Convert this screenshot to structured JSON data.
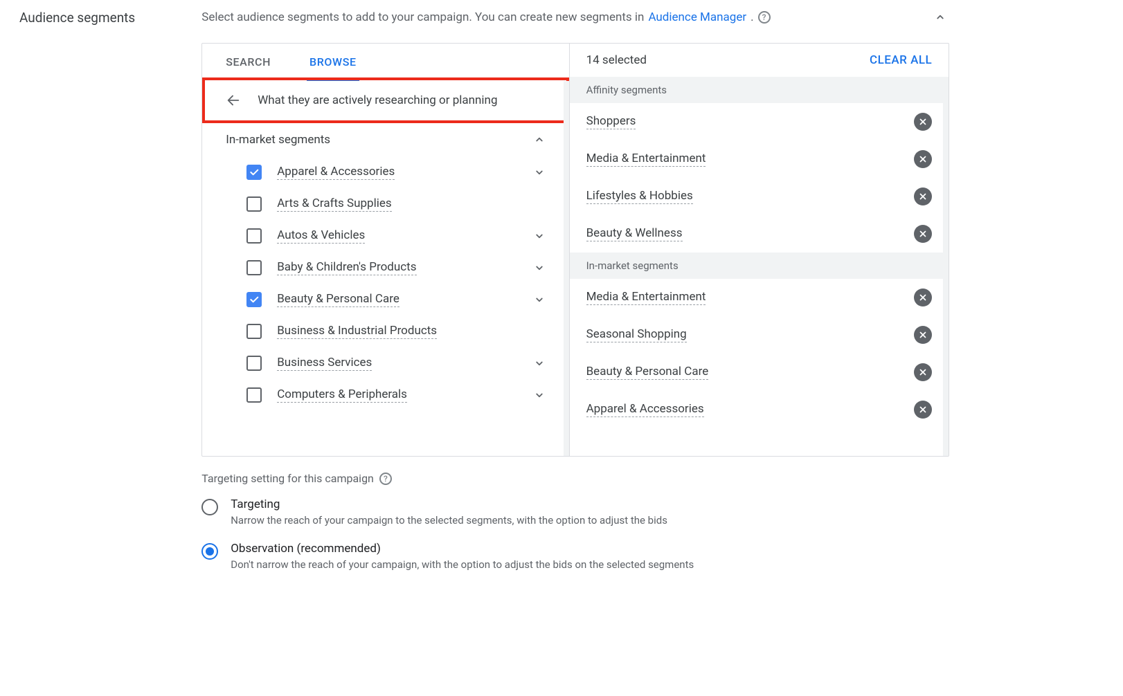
{
  "section_title": "Audience segments",
  "intro": {
    "prefix": "Select audience segments to add to your campaign. You can create new segments in ",
    "link_text": "Audience Manager",
    "suffix": "."
  },
  "tabs": {
    "search": "SEARCH",
    "browse": "BROWSE"
  },
  "crumb": "What they are actively researching or planning",
  "group_header": "In-market segments",
  "browse_items": [
    {
      "label": "Apparel & Accessories",
      "checked": true,
      "expandable": true
    },
    {
      "label": "Arts & Crafts Supplies",
      "checked": false,
      "expandable": false
    },
    {
      "label": "Autos & Vehicles",
      "checked": false,
      "expandable": true
    },
    {
      "label": "Baby & Children's Products",
      "checked": false,
      "expandable": true
    },
    {
      "label": "Beauty & Personal Care",
      "checked": true,
      "expandable": true
    },
    {
      "label": "Business & Industrial Products",
      "checked": false,
      "expandable": false
    },
    {
      "label": "Business Services",
      "checked": false,
      "expandable": true
    },
    {
      "label": "Computers & Peripherals",
      "checked": false,
      "expandable": true
    }
  ],
  "selected": {
    "count_label": "14 selected",
    "clear_all": "CLEAR ALL",
    "groups": [
      {
        "title": "Affinity segments",
        "items": [
          "Shoppers",
          "Media & Entertainment",
          "Lifestyles & Hobbies",
          "Beauty & Wellness"
        ]
      },
      {
        "title": "In-market segments",
        "items": [
          "Media & Entertainment",
          "Seasonal Shopping",
          "Beauty & Personal Care",
          "Apparel & Accessories"
        ]
      }
    ]
  },
  "targeting": {
    "heading": "Targeting setting for this campaign",
    "options": [
      {
        "label": "Targeting",
        "desc": "Narrow the reach of your campaign to the selected segments, with the option to adjust the bids",
        "selected": false
      },
      {
        "label": "Observation (recommended)",
        "desc": "Don't narrow the reach of your campaign, with the option to adjust the bids on the selected segments",
        "selected": true
      }
    ]
  }
}
